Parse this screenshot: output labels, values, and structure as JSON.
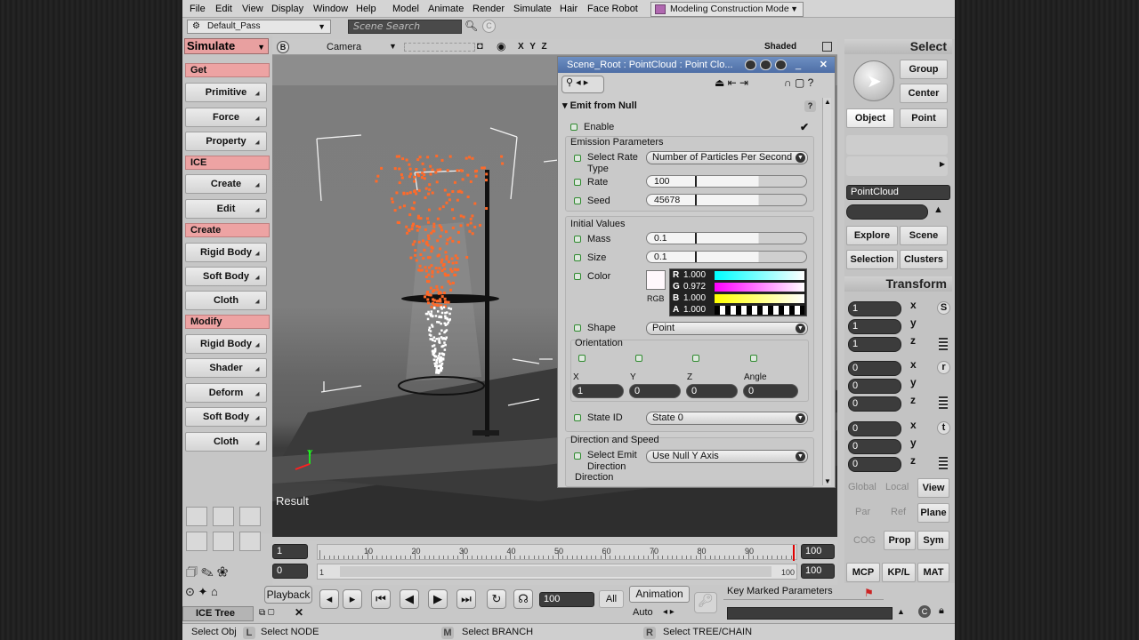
{
  "menu": [
    "File",
    "Edit",
    "View",
    "Display",
    "Window",
    "Help",
    "Model",
    "Animate",
    "Render",
    "Simulate",
    "Hair",
    "Face Robot"
  ],
  "mode": "Modeling Construction Mode",
  "pass": "Default_Pass",
  "search_placeholder": "Scene Search",
  "left": {
    "dropdown": "Simulate",
    "sections": {
      "get": "Get",
      "get_items": [
        "Primitive",
        "Force",
        "Property"
      ],
      "ice": "ICE",
      "ice_items": [
        "Create",
        "Edit"
      ],
      "create": "Create",
      "create_items": [
        "Rigid Body",
        "Soft Body",
        "Cloth"
      ],
      "modify": "Modify",
      "modify_items": [
        "Rigid Body",
        "Shader",
        "Deform",
        "Soft Body",
        "Cloth"
      ]
    }
  },
  "viewport": {
    "camera": "Camera",
    "xyz": "X Y Z",
    "shading": "Shaded",
    "b_label": "B",
    "result": "Result",
    "axis_y": "Y"
  },
  "pe": {
    "title": "Scene_Root : PointCloud : Point Clo...",
    "group": "Emit from Null",
    "enable": "Enable",
    "emission": "Emission Parameters",
    "select_rate": "Select Rate",
    "select_rate2": "Type",
    "rate_type": "Number of Particles Per Second",
    "rate_label": "Rate",
    "rate": "100",
    "seed_label": "Seed",
    "seed": "45678",
    "initial": "Initial Values",
    "mass_label": "Mass",
    "mass": "0.1",
    "size_label": "Size",
    "size": "0.1",
    "color_label": "Color",
    "rgb": "RGB",
    "r": "1.000",
    "g": "0.972",
    "b": "1.000",
    "a": "1.000",
    "shape_label": "Shape",
    "shape": "Point",
    "orientation": "Orientation",
    "ox": "X",
    "oy": "Y",
    "oz": "Z",
    "oang": "Angle",
    "vx": "1",
    "vy": "0",
    "vz": "0",
    "vang": "0",
    "state_label": "State ID",
    "state": "State 0",
    "dir_speed": "Direction and Speed",
    "select_emit": "Select Emit",
    "select_emit2": "Direction",
    "emit_dir": "Use Null Y Axis",
    "direction": "Direction"
  },
  "right": {
    "select": "Select",
    "group": "Group",
    "center": "Center",
    "object": "Object",
    "point": "Point",
    "pointcloud": "PointCloud",
    "explore": "Explore",
    "scene": "Scene",
    "selection": "Selection",
    "clusters": "Clusters",
    "transform": "Transform",
    "s_vals": [
      "1",
      "1",
      "1"
    ],
    "r_vals": [
      "0",
      "0",
      "0"
    ],
    "t_vals": [
      "0",
      "0",
      "0"
    ],
    "axes": [
      "x",
      "y",
      "z"
    ],
    "s": "S",
    "r": "r",
    "t": "t",
    "global": "Global",
    "local": "Local",
    "view": "View",
    "par": "Par",
    "ref": "Ref",
    "plane": "Plane",
    "cog": "COG",
    "prop": "Prop",
    "sym": "Sym",
    "mcp": "MCP",
    "kpl": "KP/L",
    "mat": "MAT"
  },
  "timeline": {
    "start": "1",
    "cur": "0",
    "end": "100",
    "end2": "100",
    "ticks": [
      "10",
      "20",
      "30",
      "40",
      "50",
      "60",
      "70",
      "80",
      "90"
    ],
    "range_start": "1",
    "range_end": "100",
    "playback": "Playback",
    "frame": "100",
    "all": "All",
    "animation": "Animation",
    "auto": "Auto",
    "key_marked": "Key Marked Parameters"
  },
  "ice_tree": "ICE Tree",
  "status": {
    "s1": "Select Obj",
    "m1": "L",
    "s2": "Select NODE",
    "m2": "M",
    "s3": "Select BRANCH",
    "m3": "R",
    "s4": "Select TREE/CHAIN"
  },
  "colors": {
    "section": "#eda3a3",
    "title_bar": "#5a7cb4",
    "particles": "#ff6a2a"
  }
}
